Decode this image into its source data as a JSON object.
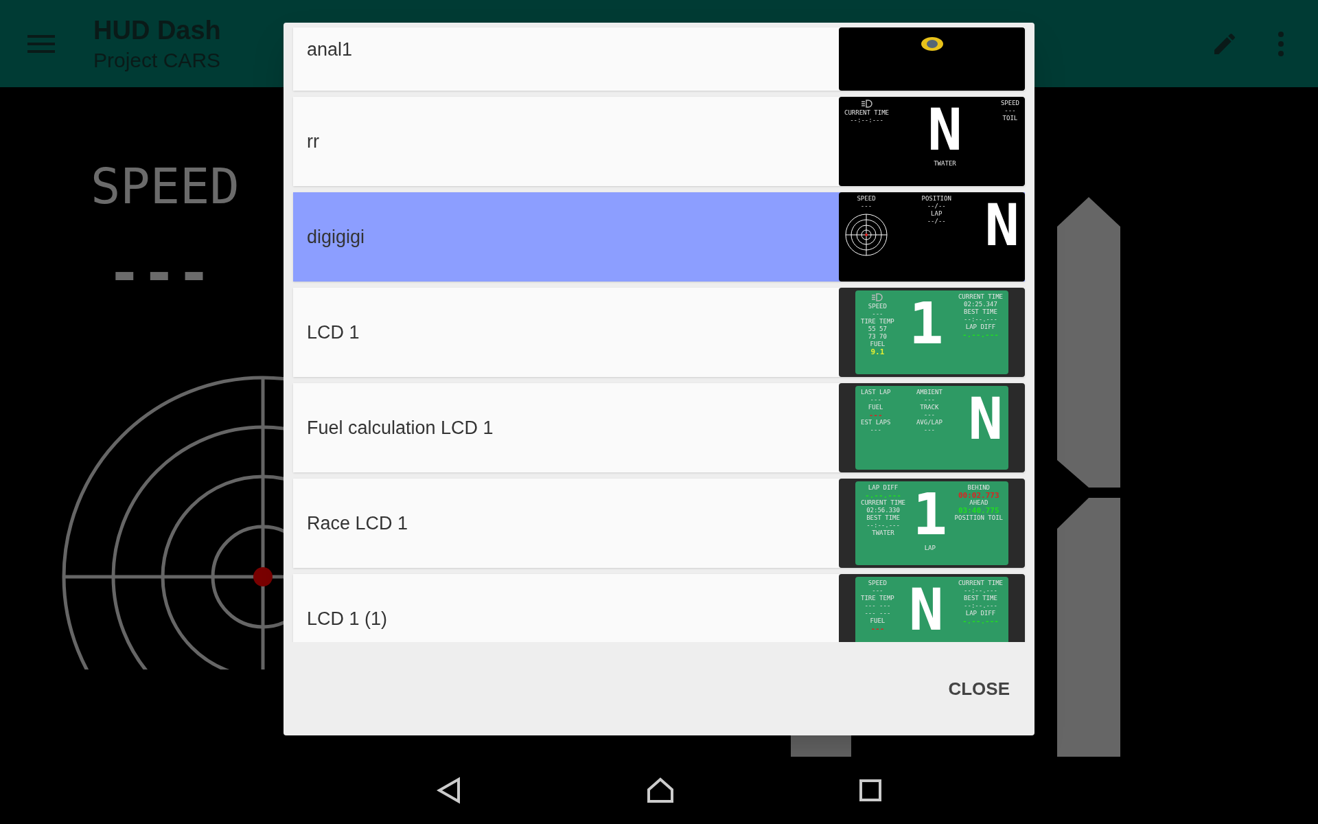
{
  "app_bar": {
    "title": "HUD Dash",
    "subtitle": "Project CARS"
  },
  "dashboard": {
    "speed_label": "SPEED",
    "speed_value": "---"
  },
  "dialog": {
    "items": [
      {
        "name": "anal1",
        "selected": false,
        "preview": {
          "kind": "logo"
        }
      },
      {
        "name": "rr",
        "selected": false,
        "preview": {
          "kind": "black",
          "columns": [
            {
              "kind": "text",
              "lamp": true,
              "lines": [
                "CURRENT TIME",
                "--:--:---"
              ]
            },
            {
              "kind": "gear",
              "text": "N",
              "under": "TWATER"
            },
            {
              "kind": "text",
              "lines": [
                "SPEED",
                "---",
                "TOIL"
              ]
            }
          ]
        }
      },
      {
        "name": "digigigi",
        "selected": true,
        "preview": {
          "kind": "black",
          "columns": [
            {
              "kind": "text",
              "radar": true,
              "lines": [
                "SPEED",
                "---"
              ]
            },
            {
              "kind": "text",
              "lines": [
                "POSITION",
                "--/--",
                "LAP",
                "--/--"
              ]
            },
            {
              "kind": "gear",
              "text": "N"
            }
          ]
        }
      },
      {
        "name": "LCD 1",
        "selected": false,
        "preview": {
          "kind": "lcd",
          "columns": [
            {
              "kind": "text",
              "lamp": true,
              "lines": [
                "SPEED",
                "---",
                "TIRE TEMP",
                "55 57",
                "73 70",
                "FUEL",
                {
                  "text": "9.1",
                  "color": "#e5f032"
                }
              ]
            },
            {
              "kind": "gear",
              "text": "1"
            },
            {
              "kind": "text",
              "lines": [
                "CURRENT TIME",
                "02:25.347",
                "BEST TIME",
                "--:--.---",
                "LAP DIFF",
                {
                  "text": "-.--.---",
                  "color": "#22dd22"
                }
              ]
            }
          ]
        }
      },
      {
        "name": "Fuel calculation LCD 1",
        "selected": false,
        "preview": {
          "kind": "lcd",
          "columns": [
            {
              "kind": "text",
              "lines": [
                "LAST LAP",
                "---",
                "FUEL",
                {
                  "text": "---",
                  "color": "#dd2222"
                },
                "EST LAPS",
                "---"
              ]
            },
            {
              "kind": "text",
              "lines": [
                "AMBIENT",
                "---",
                "TRACK",
                "---",
                "AVG/LAP",
                "---"
              ]
            },
            {
              "kind": "gear",
              "text": "N"
            }
          ]
        }
      },
      {
        "name": "Race LCD 1",
        "selected": false,
        "preview": {
          "kind": "lcd",
          "columns": [
            {
              "kind": "text",
              "lines": [
                "LAP DIFF",
                {
                  "text": "-.--.---",
                  "color": "#22dd22"
                },
                "CURRENT TIME",
                "02:56.330",
                "BEST TIME",
                "--:--.---",
                "TWATER"
              ]
            },
            {
              "kind": "gear",
              "text": "1",
              "under": "LAP"
            },
            {
              "kind": "text",
              "lines": [
                "BEHIND",
                {
                  "text": "00:02.773",
                  "color": "#dd2222"
                },
                "AHEAD",
                {
                  "text": "03:40.775",
                  "color": "#22dd22"
                },
                "POSITION  TOIL"
              ]
            }
          ]
        }
      },
      {
        "name": "LCD 1 (1)",
        "selected": false,
        "preview": {
          "kind": "lcd",
          "columns": [
            {
              "kind": "text",
              "lines": [
                "SPEED",
                "---",
                "TIRE TEMP",
                "--- ---",
                "--- ---",
                "FUEL",
                {
                  "text": "---",
                  "color": "#dd2222"
                }
              ]
            },
            {
              "kind": "gear",
              "text": "N"
            },
            {
              "kind": "text",
              "lines": [
                "CURRENT TIME",
                "--:--.---",
                "BEST TIME",
                "--:--.---",
                "LAP DIFF",
                {
                  "text": "-.--.---",
                  "color": "#22dd22"
                }
              ]
            }
          ]
        }
      }
    ],
    "close_button": "CLOSE"
  }
}
